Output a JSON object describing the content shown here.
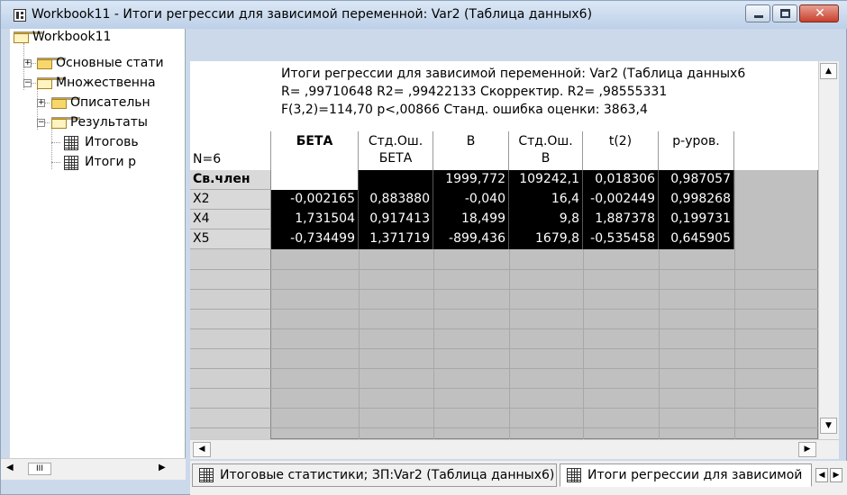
{
  "window": {
    "title": "Workbook11 - Итоги регрессии для зависимой переменной: Var2 (Таблица данных6)",
    "controls": {
      "minimize": "—",
      "maximize": "□",
      "close": "✕"
    }
  },
  "tree": {
    "root": "Workbook11",
    "items": [
      {
        "label": "Основные стати",
        "expander": "+"
      },
      {
        "label": "Множественна",
        "expander": "−"
      },
      {
        "label": "Описательн",
        "expander": "+"
      },
      {
        "label": "Результаты",
        "expander": "−"
      },
      {
        "label": "Итоговь"
      },
      {
        "label": "Итоги р"
      }
    ],
    "scroll": {
      "left": "◀",
      "thumb": "III",
      "right": "▶"
    }
  },
  "sheet": {
    "header_lines": [
      "Итоги регрессии для зависимой переменной: Var2 (Таблица данных6",
      "R= ,99710648 R2= ,99422133 Скорректир. R2= ,98555331",
      "F(3,2)=114,70 p<,00866 Станд. ошибка оценки: 3863,4"
    ],
    "n_label": "N=6",
    "columns": [
      {
        "line1": "БЕТА",
        "line2": ""
      },
      {
        "line1": "Стд.Ош.",
        "line2": "БЕТА"
      },
      {
        "line1": "B",
        "line2": ""
      },
      {
        "line1": "Стд.Ош.",
        "line2": "B"
      },
      {
        "line1": "t(2)",
        "line2": ""
      },
      {
        "line1": "p-уров.",
        "line2": ""
      }
    ],
    "rows": [
      {
        "label": "Св.член",
        "cells": [
          "",
          "",
          "1999,772",
          "109242,1",
          "0,018306",
          "0,987057"
        ]
      },
      {
        "label": "X2",
        "cells": [
          "-0,002165",
          "0,883880",
          "-0,040",
          "16,4",
          "-0,002449",
          "0,998268"
        ]
      },
      {
        "label": "X4",
        "cells": [
          "1,731504",
          "0,917413",
          "18,499",
          "9,8",
          "1,887378",
          "0,199731"
        ]
      },
      {
        "label": "X5",
        "cells": [
          "-0,734499",
          "1,371719",
          "-899,436",
          "1679,8",
          "-0,535458",
          "0,645905"
        ]
      }
    ],
    "scroll": {
      "up": "▲",
      "down": "▼",
      "left": "◀",
      "right": "▶"
    }
  },
  "tabs": [
    {
      "label": "Итоговые статистики; ЗП:Var2 (Таблица данных6)"
    },
    {
      "label": "Итоги регрессии для зависимой"
    }
  ],
  "tab_nav": {
    "prev": "◀",
    "next": "▶"
  }
}
